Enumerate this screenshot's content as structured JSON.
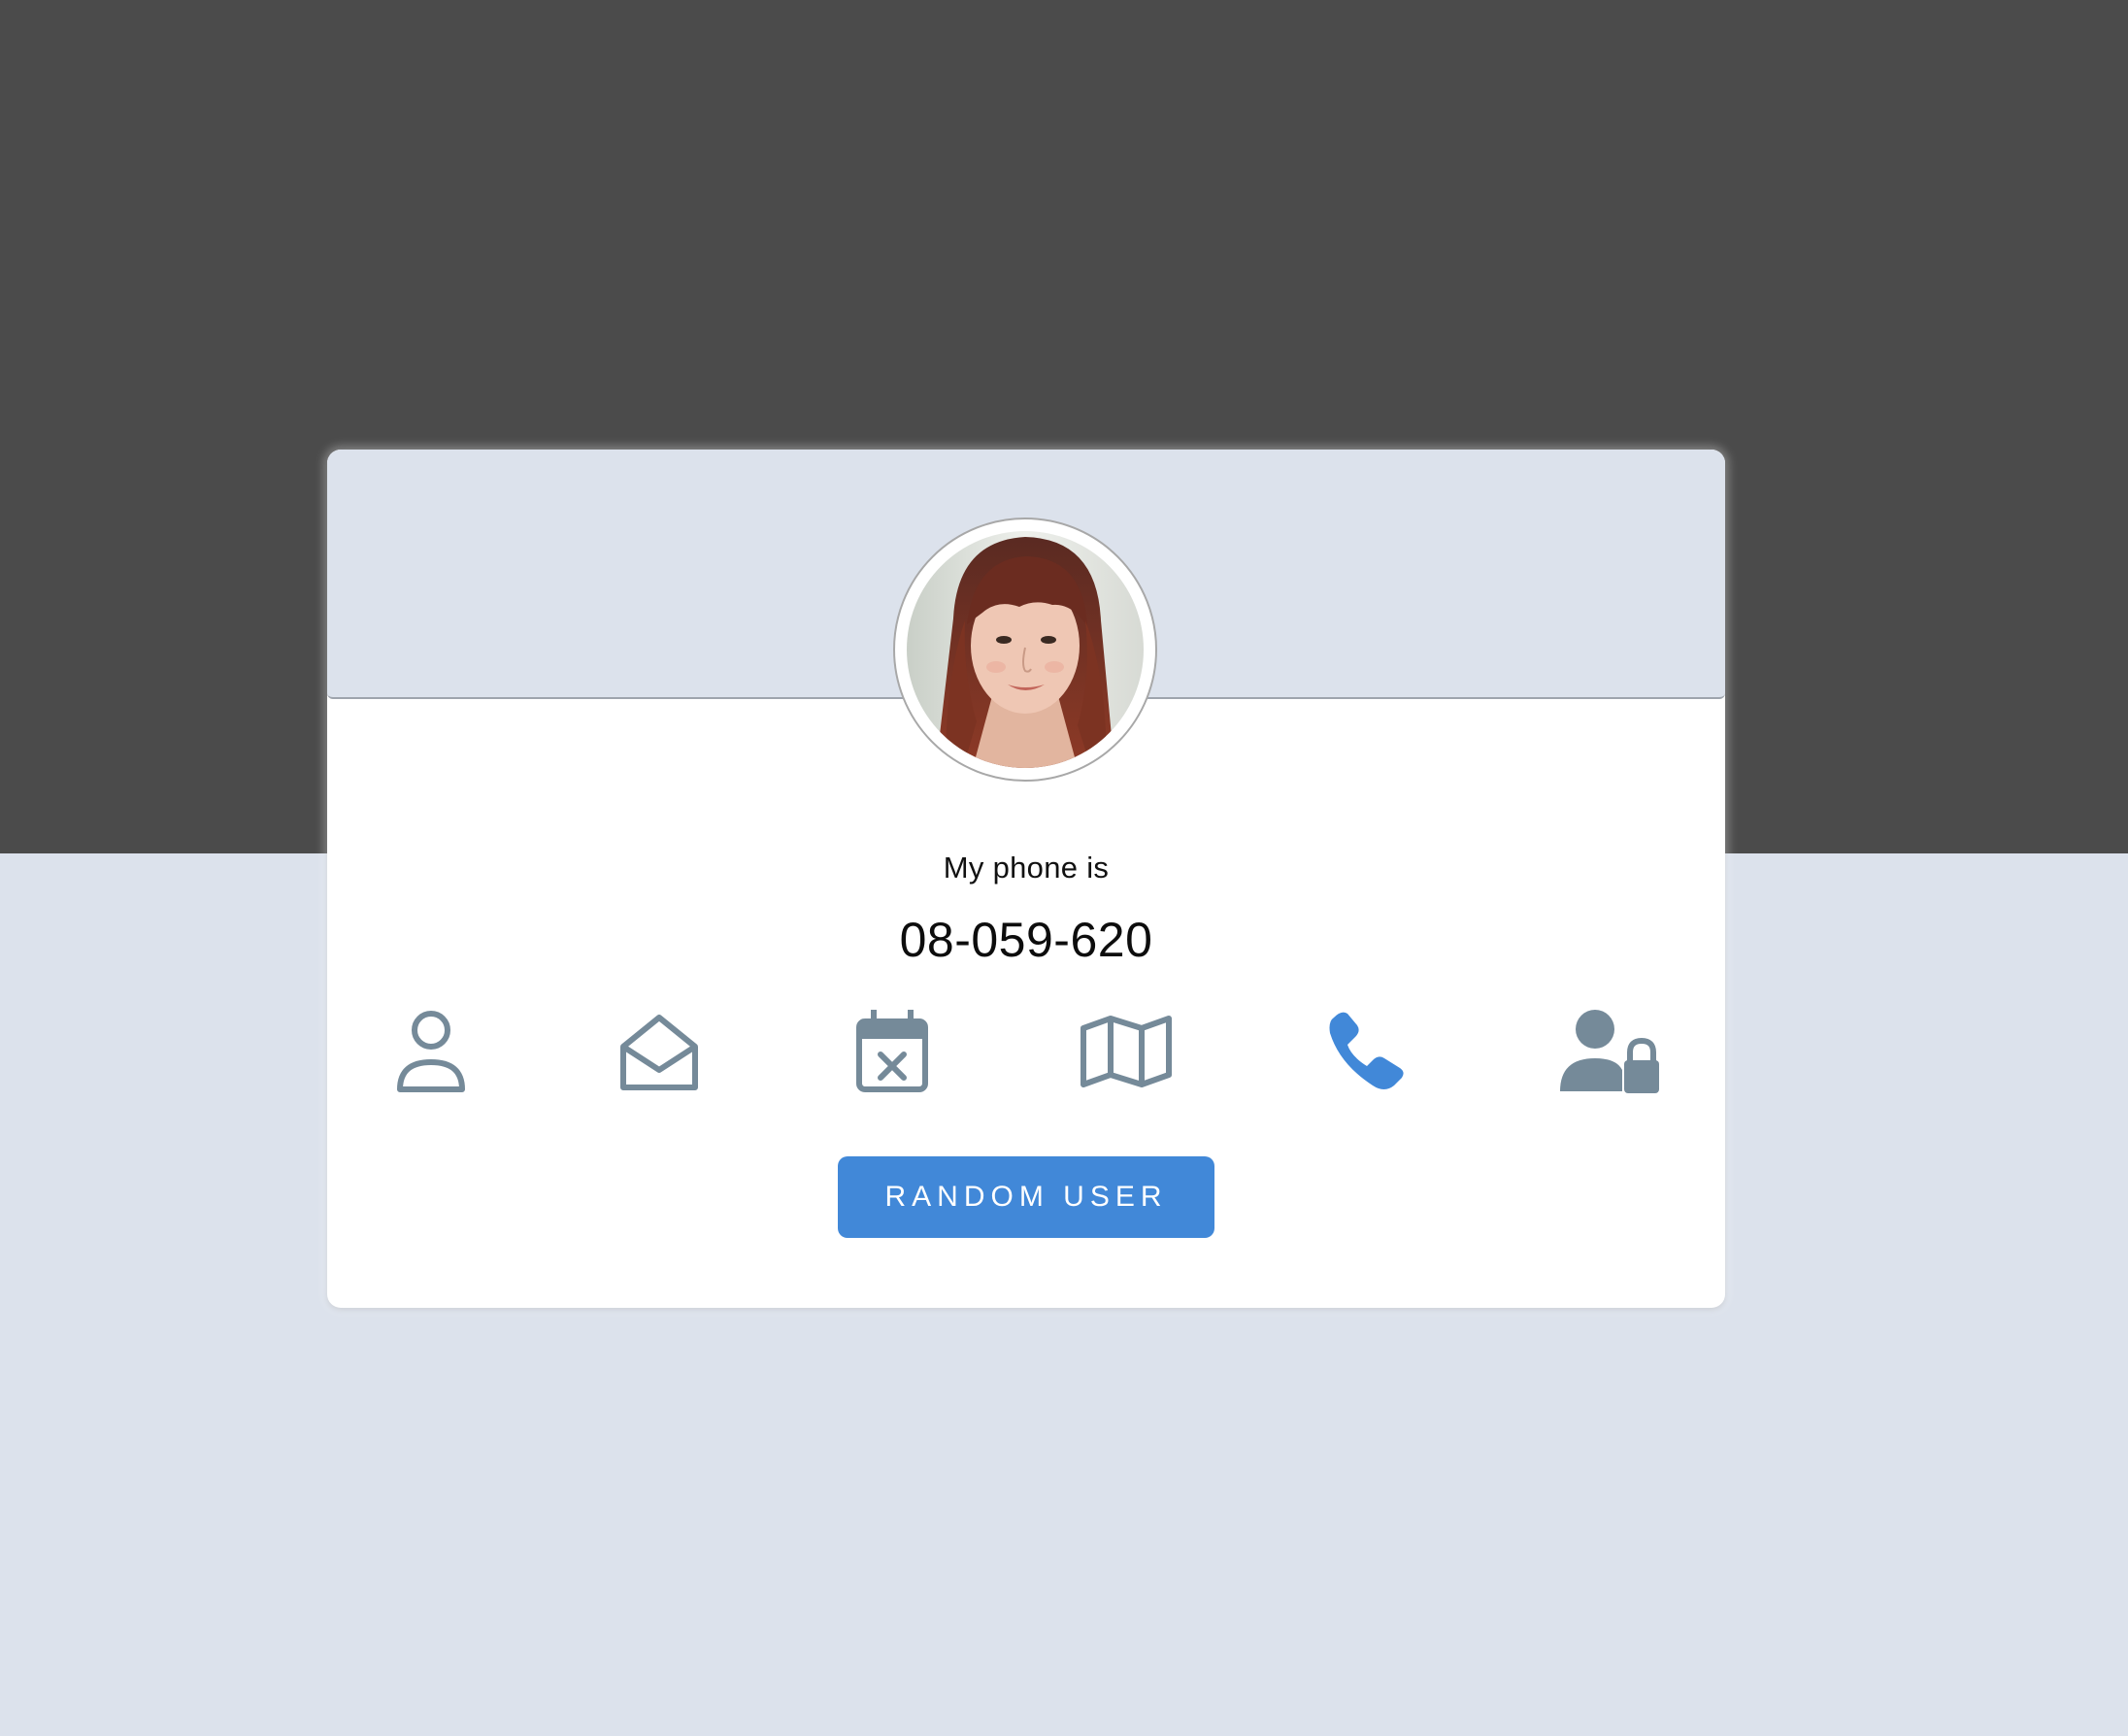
{
  "profile": {
    "label": "My phone is",
    "value": "08-059-620"
  },
  "icons": [
    {
      "name": "user-icon",
      "active": false
    },
    {
      "name": "envelope-open-icon",
      "active": false
    },
    {
      "name": "calendar-x-icon",
      "active": false
    },
    {
      "name": "map-icon",
      "active": false
    },
    {
      "name": "phone-icon",
      "active": true
    },
    {
      "name": "user-lock-icon",
      "active": false
    }
  ],
  "button": {
    "label": "RANDOM USER"
  },
  "colors": {
    "icon_default": "#758a99",
    "icon_active": "#4188d8",
    "button_bg": "#4188d8",
    "header_bg": "#dce2ec",
    "page_top": "#4b4b4b",
    "page_bottom": "#dce2ec"
  }
}
